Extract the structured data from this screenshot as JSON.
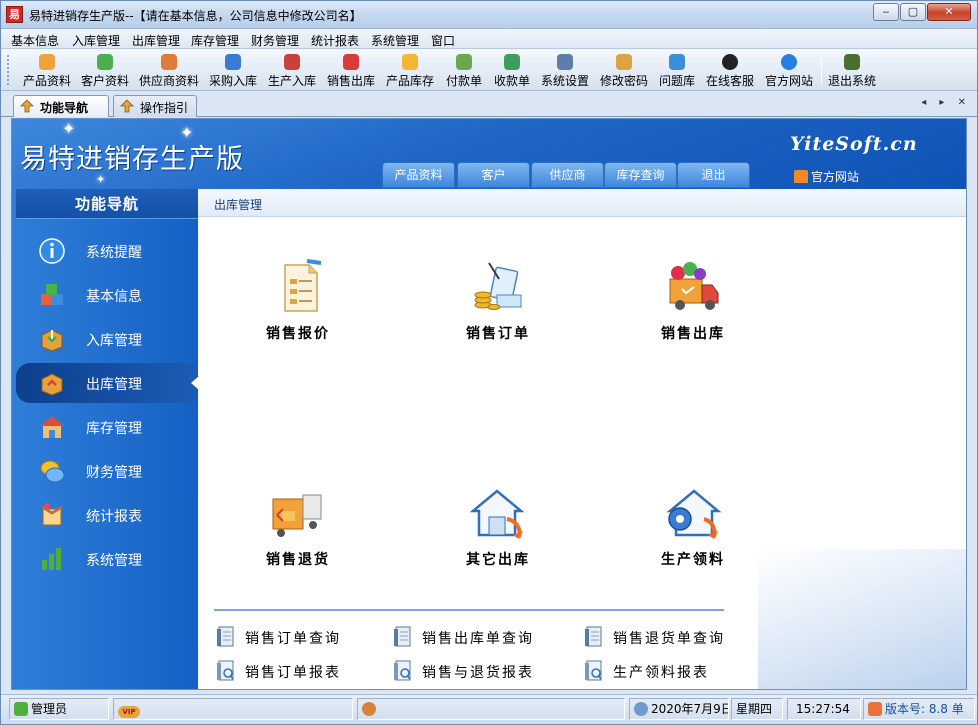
{
  "window": {
    "title": "易特进销存生产版--【请在基本信息，公司信息中修改公司名】",
    "controls": {
      "minimize": "‒",
      "maximize": "▢",
      "close": "✕"
    }
  },
  "menubar": [
    "基本信息",
    "入库管理",
    "出库管理",
    "库存管理",
    "财务管理",
    "统计报表",
    "系统管理",
    "窗口"
  ],
  "toolbar": [
    {
      "label": "产品资料",
      "icon": "product-icon",
      "color": "#f0a23a"
    },
    {
      "label": "客户资料",
      "icon": "customer-icon",
      "color": "#4cae4c"
    },
    {
      "label": "供应商资料",
      "icon": "supplier-icon",
      "color": "#e07b39"
    },
    {
      "label": "采购入库",
      "icon": "purchase-in-icon",
      "color": "#3a7bd5"
    },
    {
      "label": "生产入库",
      "icon": "production-in-icon",
      "color": "#c9413c"
    },
    {
      "label": "销售出库",
      "icon": "sales-out-icon",
      "color": "#d93a3a"
    },
    {
      "label": "产品库存",
      "icon": "product-stock-icon",
      "color": "#f2b632"
    },
    {
      "label": "付款单",
      "icon": "payment-icon",
      "color": "#6aa84f"
    },
    {
      "label": "收款单",
      "icon": "receipt-icon",
      "color": "#3f9e5e"
    },
    {
      "label": "系统设置",
      "icon": "settings-icon",
      "color": "#5c7ea8"
    },
    {
      "label": "修改密码",
      "icon": "password-icon",
      "color": "#d9a441"
    },
    {
      "label": "问题库",
      "icon": "faq-icon",
      "color": "#3b8ed8"
    },
    {
      "label": "在线客服",
      "icon": "online-service-icon",
      "color": "#222222"
    },
    {
      "label": "官方网站",
      "icon": "ie-icon",
      "color": "#2a7de1"
    },
    {
      "label": "退出系统",
      "icon": "exit-icon",
      "color": "#4a6f2f"
    }
  ],
  "tabs": [
    {
      "label": "功能导航",
      "active": true
    },
    {
      "label": "操作指引",
      "active": false
    }
  ],
  "tabstrip_controls": "◂ ▸ ✕",
  "banner": {
    "title": "易特进销存生产版",
    "brand": "YiteSoft.cn",
    "site_label": "官方网站",
    "nav": [
      "产品资料",
      "客户",
      "供应商",
      "库存查询",
      "退出"
    ]
  },
  "sidebar": {
    "header": "功能导航",
    "items": [
      {
        "label": "系统提醒",
        "icon": "info-icon",
        "color": "#2f8be5"
      },
      {
        "label": "基本信息",
        "icon": "cubes-icon",
        "color": "#e85f3c"
      },
      {
        "label": "入库管理",
        "icon": "box-in-icon",
        "color": "#e3a23b"
      },
      {
        "label": "出库管理",
        "icon": "box-out-icon",
        "color": "#e3a23b",
        "active": true
      },
      {
        "label": "库存管理",
        "icon": "warehouse-icon",
        "color": "#d9823a"
      },
      {
        "label": "财务管理",
        "icon": "finance-icon",
        "color": "#f2c12e"
      },
      {
        "label": "统计报表",
        "icon": "report-icon",
        "color": "#c9653a"
      },
      {
        "label": "系统管理",
        "icon": "bar-chart-icon",
        "color": "#4fae3d"
      }
    ]
  },
  "main": {
    "title": "出库管理",
    "modules": [
      {
        "label": "销售报价",
        "icon": "quote-document-icon"
      },
      {
        "label": "销售订单",
        "icon": "sales-order-icon"
      },
      {
        "label": "销售出库",
        "icon": "delivery-truck-icon"
      },
      {
        "label": "销售退货",
        "icon": "return-truck-icon"
      },
      {
        "label": "其它出库",
        "icon": "other-out-house-icon"
      },
      {
        "label": "生产领料",
        "icon": "material-requisition-icon"
      }
    ],
    "links": [
      {
        "label": "销售订单查询",
        "icon": "query-icon"
      },
      {
        "label": "销售出库单查询",
        "icon": "query-icon"
      },
      {
        "label": "销售退货单查询",
        "icon": "query-icon"
      },
      {
        "label": "销售订单报表",
        "icon": "report-doc-icon"
      },
      {
        "label": "销售与退货报表",
        "icon": "report-doc-icon"
      },
      {
        "label": "生产领料报表",
        "icon": "report-doc-icon"
      }
    ]
  },
  "statusbar": {
    "user": "管理员",
    "vip": "VIP",
    "date": "2020年7月9日",
    "weekday": "星期四",
    "time": "15:27:54",
    "version": "版本号: 8.8 单"
  }
}
